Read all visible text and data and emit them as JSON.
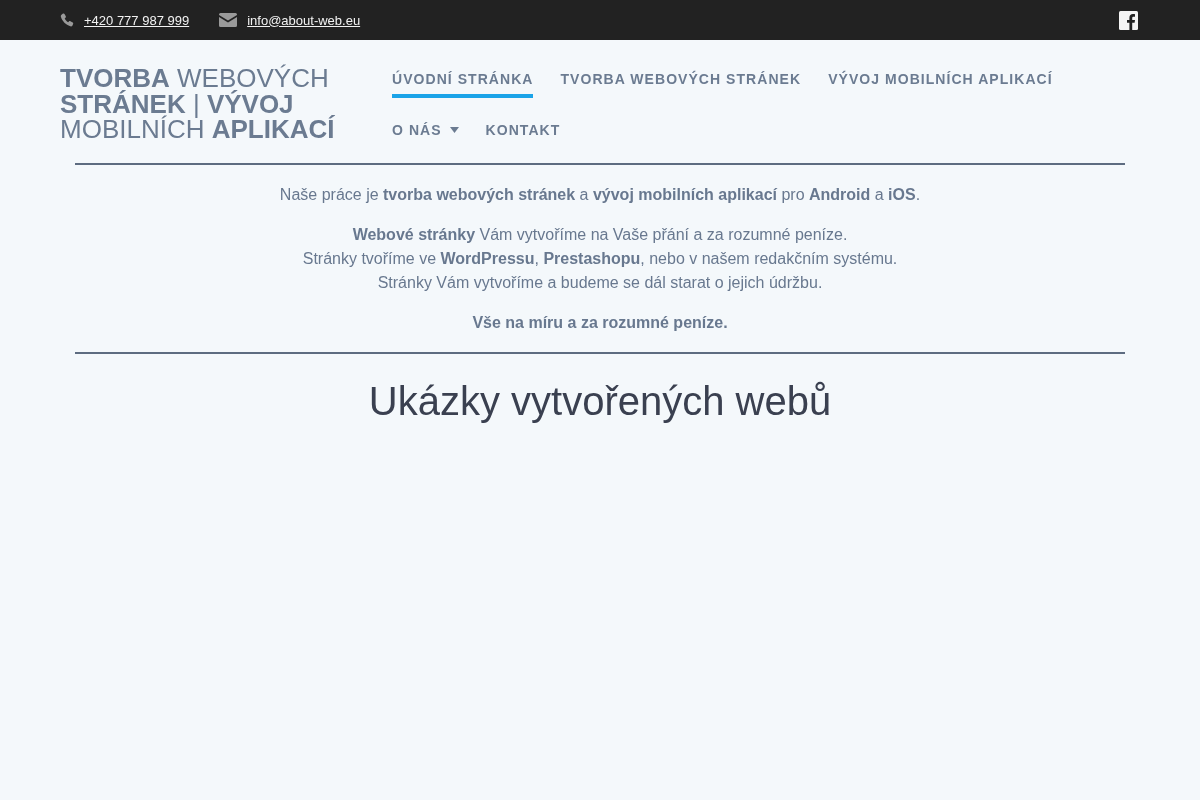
{
  "top_bar": {
    "phone": "+420 777 987 999",
    "email": "info@about-web.eu"
  },
  "logo": "**TVORBA** WEBOVÝCH **STRÁNEK** | **VÝVOJ** MOBILNÍCH **APLIKACÍ**",
  "nav": [
    {
      "label": "ÚVODNÍ STRÁNKA",
      "selected": true,
      "dropdown": false
    },
    {
      "label": "TVORBA WEBOVÝCH STRÁNEK",
      "selected": false,
      "dropdown": false
    },
    {
      "label": "VÝVOJ MOBILNÍCH APLIKACÍ",
      "selected": false,
      "dropdown": false
    },
    {
      "label": "O NÁS",
      "selected": false,
      "dropdown": true
    },
    {
      "label": "KONTAKT",
      "selected": false,
      "dropdown": false
    }
  ],
  "intro": {
    "paragraphs": [
      [
        "Naše práce je **tvorba webových stránek** a **vývoj mobilních aplikací** pro **Android** a **iOS**."
      ],
      [
        "**Webové stránky** Vám vytvoříme na Vaše přání a za rozumné peníze.",
        "Stránky tvoříme ve **WordPressu**, **Prestashopu**, nebo v našem redakčním systému.",
        "Stránky Vám vytvoříme a budeme se dál starat o jejich údržbu."
      ]
    ],
    "closing": "Vše na míru a za rozumné peníze."
  },
  "heading": "Ukázky vytvořených webů"
}
